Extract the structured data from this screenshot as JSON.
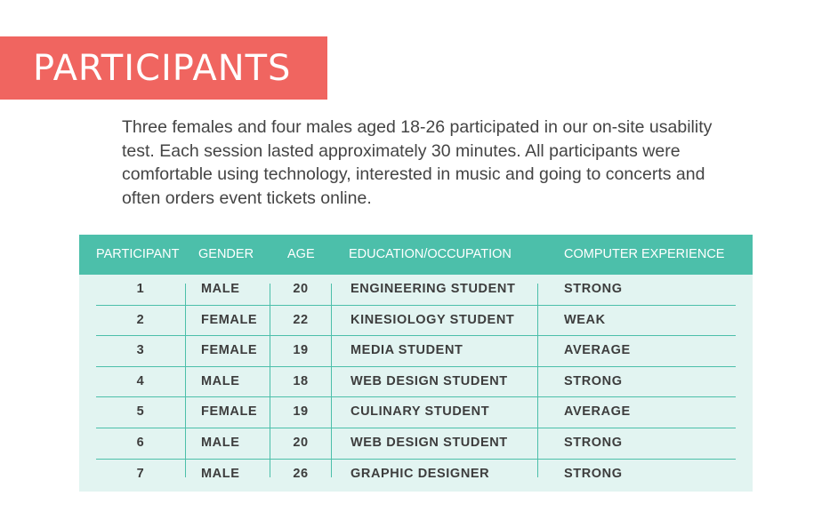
{
  "title": "PARTICIPANTS",
  "intro": "Three females and four males aged 18-26 participated in our on-site usability test. Each session lasted approximately 30 minutes. All participants were comfortable using technology, interested in music and going to concerts and often orders event tickets online.",
  "colors": {
    "banner": "#f06560",
    "table_header": "#4cbfaa",
    "table_body": "#e2f4f1"
  },
  "table": {
    "headers": [
      "PARTICIPANT",
      "GENDER",
      "AGE",
      "EDUCATION/OCCUPATION",
      "COMPUTER EXPERIENCE"
    ],
    "rows": [
      [
        "1",
        "MALE",
        "20",
        "ENGINEERING STUDENT",
        "STRONG"
      ],
      [
        "2",
        "FEMALE",
        "22",
        "KINESIOLOGY STUDENT",
        "WEAK"
      ],
      [
        "3",
        "FEMALE",
        "19",
        "MEDIA STUDENT",
        "AVERAGE"
      ],
      [
        "4",
        "MALE",
        "18",
        "WEB DESIGN STUDENT",
        "STRONG"
      ],
      [
        "5",
        "FEMALE",
        "19",
        "CULINARY STUDENT",
        "AVERAGE"
      ],
      [
        "6",
        "MALE",
        "20",
        "WEB DESIGN STUDENT",
        "STRONG"
      ],
      [
        "7",
        "MALE",
        "26",
        "GRAPHIC DESIGNER",
        "STRONG"
      ]
    ]
  }
}
